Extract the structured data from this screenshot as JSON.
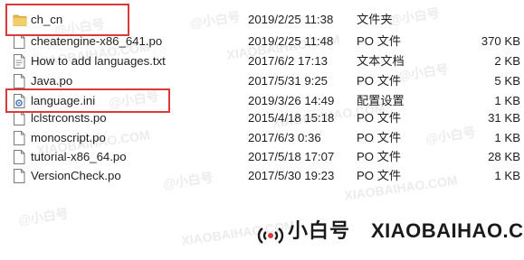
{
  "files": [
    {
      "name": "ch_cn",
      "date": "2019/2/25 11:38",
      "type": "文件夹",
      "size": "",
      "icon": "folder-icon",
      "highlighted": true
    },
    {
      "name": "cheatengine-x86_641.po",
      "date": "2019/2/25 11:48",
      "type": "PO 文件",
      "size": "370 KB",
      "icon": "document-icon"
    },
    {
      "name": "How to add languages.txt",
      "date": "2017/6/2 17:13",
      "type": "文本文档",
      "size": "2 KB",
      "icon": "text-document-icon"
    },
    {
      "name": "Java.po",
      "date": "2017/5/31 9:25",
      "type": "PO 文件",
      "size": "5 KB",
      "icon": "document-icon"
    },
    {
      "name": "language.ini",
      "date": "2019/3/26 14:49",
      "type": "配置设置",
      "size": "1 KB",
      "icon": "settings-file-icon",
      "highlighted": true
    },
    {
      "name": "lclstrconsts.po",
      "date": "2015/4/18 15:18",
      "type": "PO 文件",
      "size": "31 KB",
      "icon": "document-icon"
    },
    {
      "name": "monoscript.po",
      "date": "2017/6/3 0:36",
      "type": "PO 文件",
      "size": "1 KB",
      "icon": "document-icon"
    },
    {
      "name": "tutorial-x86_64.po",
      "date": "2017/5/18 17:07",
      "type": "PO 文件",
      "size": "28 KB",
      "icon": "document-icon"
    },
    {
      "name": "VersionCheck.po",
      "date": "2017/5/30 19:23",
      "type": "PO 文件",
      "size": "1 KB",
      "icon": "document-icon"
    }
  ],
  "watermark": {
    "cn": "@小白号",
    "en": "XIAOBAIHAO.COM"
  },
  "brand": {
    "cn": "小白号",
    "en": "XIAOBAIHAO.COM"
  },
  "colors": {
    "highlight": "#d93a3a",
    "folder": "#e8b84a",
    "text": "#1e1e1e"
  }
}
